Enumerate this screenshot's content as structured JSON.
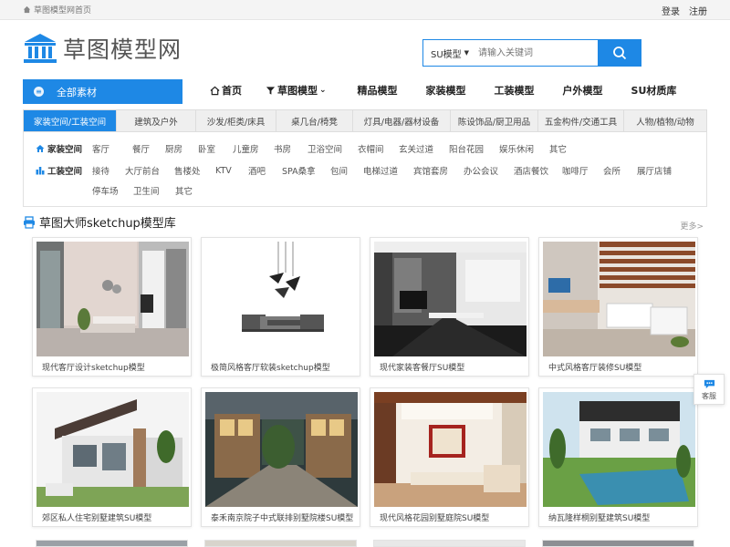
{
  "topbar": {
    "home_text": "草图模型网首页",
    "login": "登录",
    "register": "注册"
  },
  "logo": {
    "text": "草图模型网"
  },
  "search": {
    "select_value": "SU模型",
    "placeholder": "请输入关键词"
  },
  "all_category": {
    "label": "全部素材"
  },
  "nav": [
    {
      "label": "首页",
      "icon": "home-icon"
    },
    {
      "label": "草图模型",
      "icon": "filter-icon",
      "dropdown": true
    },
    {
      "label": "精品模型"
    },
    {
      "label": "家装模型"
    },
    {
      "label": "工装模型"
    },
    {
      "label": "户外模型"
    },
    {
      "label": "SU材质库"
    }
  ],
  "category_tabs": [
    "家装空间/工装空间",
    "建筑及户外",
    "沙发/柜类/床具",
    "桌几台/椅凳",
    "灯具/电器/器材设备",
    "陈设饰品/厨卫用品",
    "五金构件/交通工具",
    "人物/植物/动物"
  ],
  "active_tab": 0,
  "home_space": {
    "label": "家装空间",
    "items": [
      "客厅",
      "餐厅",
      "厨房",
      "卧室",
      "儿童房",
      "书房",
      "卫浴空间",
      "衣帽间",
      "玄关过道",
      "阳台花园",
      "娱乐休闲",
      "其它"
    ]
  },
  "work_space": {
    "label": "工装空间",
    "items_row1": [
      "接待",
      "大厅前台",
      "售楼处",
      "KTV",
      "酒吧",
      "SPA桑拿",
      "包间",
      "电梯过道",
      "宾馆套房",
      "办公会议",
      "酒店餐饮",
      "咖啡厅",
      "会所",
      "展厅店铺"
    ],
    "items_row2": [
      "停车场",
      "卫生间",
      "其它"
    ]
  },
  "section": {
    "title": "草图大师sketchup模型库",
    "more": "更多>"
  },
  "cards": [
    {
      "caption": "现代客厅设计sketchup模型",
      "scene": "living-modern"
    },
    {
      "caption": "极简风格客厅软装sketchup模型",
      "scene": "minimal-lounge"
    },
    {
      "caption": "现代家装客餐厅SU模型",
      "scene": "dark-living"
    },
    {
      "caption": "中式风格客厅装修SU模型",
      "scene": "chinese-living"
    },
    {
      "caption": "郊区私人住宅别墅建筑SU模型",
      "scene": "villa-suburb"
    },
    {
      "caption": "泰禾南京院子中式联排别墅院楼SU模型",
      "scene": "courtyard-night"
    },
    {
      "caption": "现代风格花园别墅庭院SU模型",
      "scene": "garden-interior"
    },
    {
      "caption": "纳瓦隆样桐别墅建筑SU模型",
      "scene": "villa-pool"
    }
  ],
  "float_service": {
    "label": "客服"
  },
  "colors": {
    "accent": "#1e88e5",
    "tab_bg": "#efefef"
  }
}
